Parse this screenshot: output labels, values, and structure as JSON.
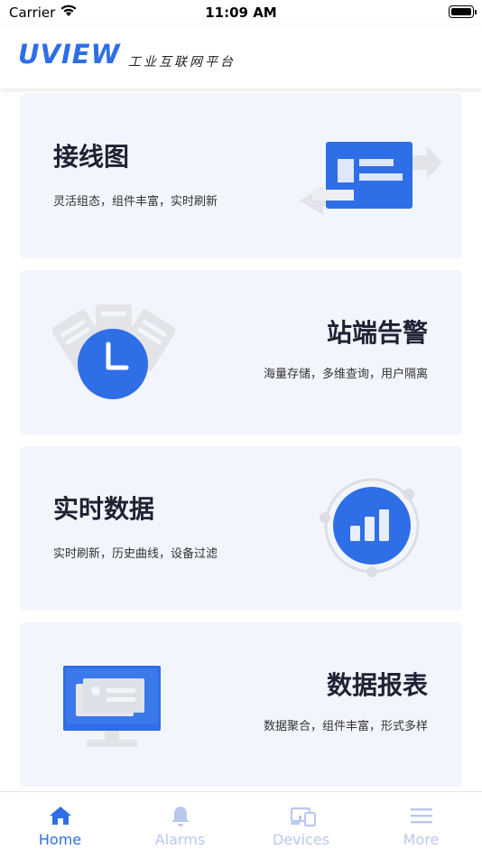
{
  "status_bar": {
    "carrier": "Carrier",
    "time": "11:09 AM"
  },
  "header": {
    "logo": "UVIEW",
    "subtitle": "工业互联网平台"
  },
  "cards": [
    {
      "title": "接线图",
      "subtitle": "灵活组态，组件丰富，实时刷新",
      "icon": "wiring-diagram-icon"
    },
    {
      "title": "站端告警",
      "subtitle": "海量存储，多维查询，用户隔离",
      "icon": "clock-alarm-icon"
    },
    {
      "title": "实时数据",
      "subtitle": "实时刷新，历史曲线，设备过滤",
      "icon": "bar-chart-icon"
    },
    {
      "title": "数据报表",
      "subtitle": "数据聚合，组件丰富，形式多样",
      "icon": "monitor-report-icon"
    }
  ],
  "tabbar": {
    "items": [
      {
        "label": "Home",
        "icon": "home-icon",
        "active": true
      },
      {
        "label": "Alarms",
        "icon": "bell-icon",
        "active": false
      },
      {
        "label": "Devices",
        "icon": "devices-icon",
        "active": false
      },
      {
        "label": "More",
        "icon": "menu-icon",
        "active": false
      }
    ],
    "active_color": "#2e6ee6",
    "inactive_color": "#b9c8ef"
  },
  "colors": {
    "accent": "#2e6ee6",
    "card_bg": "#f2f5fc"
  }
}
